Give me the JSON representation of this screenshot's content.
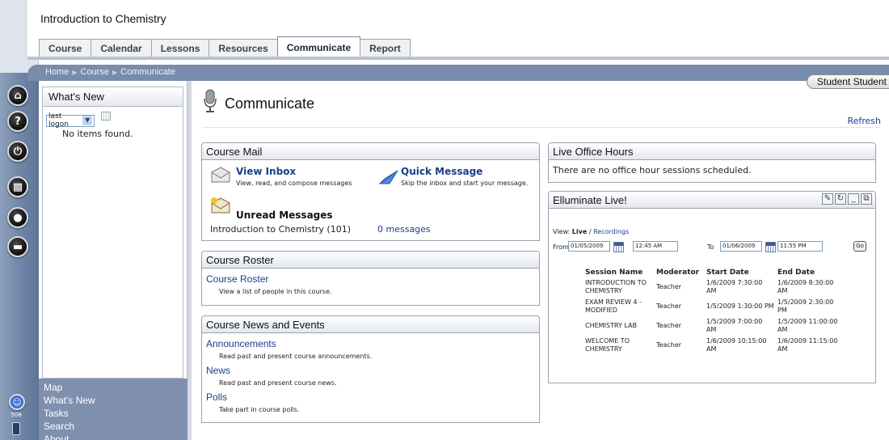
{
  "header": {
    "course_title": "Introduction to Chemistry",
    "tabs": [
      {
        "label": "Course"
      },
      {
        "label": "Calendar"
      },
      {
        "label": "Lessons"
      },
      {
        "label": "Resources"
      },
      {
        "label": "Communicate"
      },
      {
        "label": "Report"
      }
    ],
    "active_tab": "Communicate"
  },
  "breadcrumb": [
    "Home",
    "Course",
    "Communicate"
  ],
  "user": {
    "name": "Student Student"
  },
  "rail": {
    "icons": [
      "home-icon",
      "help-icon",
      "power-icon",
      "briefcase-icon",
      "person-icon",
      "chat-icon"
    ],
    "bottom_label": "508",
    "bottom_icons": [
      "accessibility-icon",
      "pda-icon"
    ]
  },
  "sidebar": {
    "title": "What's New",
    "filter_value": "last logon",
    "empty_text": "No items found.",
    "links": [
      "Map",
      "What's New",
      "Tasks",
      "Search",
      "About"
    ]
  },
  "page": {
    "title": "Communicate",
    "refresh_label": "Refresh"
  },
  "course_mail": {
    "title": "Course Mail",
    "view_inbox": {
      "label": "View Inbox",
      "desc": "View, read, and compose messages"
    },
    "quick_message": {
      "label": "Quick Message",
      "desc": "Skip the inbox and start your message."
    },
    "unread": {
      "label": "Unread Messages",
      "course": "Introduction to Chemistry (101)",
      "count_link": "0 messages"
    }
  },
  "course_roster": {
    "title": "Course Roster",
    "link": "Course Roster",
    "desc": "View a list of people in this course."
  },
  "news_events": {
    "title": "Course News and Events",
    "items": [
      {
        "label": "Announcements",
        "desc": "Read past and present course announcements."
      },
      {
        "label": "News",
        "desc": "Read past and present course news."
      },
      {
        "label": "Polls",
        "desc": "Take part in course polls."
      }
    ]
  },
  "office_hours": {
    "title": "Live Office Hours",
    "text": "There are no office hour sessions scheduled."
  },
  "elluminate": {
    "title": "Elluminate Live!",
    "view_label": "View:",
    "view_live": "Live",
    "view_sep": "/",
    "view_recordings": "Recordings",
    "from_label": "From",
    "from_date": "01/05/2009",
    "from_time": "12:45 AM",
    "to_label": "To",
    "to_date": "01/06/2009",
    "to_time": "11:55 PM",
    "go_label": "Go",
    "columns": [
      "Session Name",
      "Moderator",
      "Start Date",
      "End Date"
    ],
    "rows": [
      {
        "name": "INTRODUCTION TO CHEMISTRY",
        "moderator": "Teacher",
        "start": "1/6/2009 7:30:00 AM",
        "end": "1/6/2009 8:30:00 AM"
      },
      {
        "name": "EXAM REVIEW 4 - MODIFIED",
        "moderator": "Teacher",
        "start": "1/5/2009 1:30:00 PM",
        "end": "1/5/2009 2:30:00 PM"
      },
      {
        "name": "CHEMISTRY LAB",
        "moderator": "Teacher",
        "start": "1/5/2009 7:00:00 AM",
        "end": "1/5/2009 11:00:00 AM"
      },
      {
        "name": "WELCOME TO CHEMISTRY",
        "moderator": "Teacher",
        "start": "1/6/2009 10:15:00 AM",
        "end": "1/6/2009 11:15:00 AM"
      }
    ]
  }
}
